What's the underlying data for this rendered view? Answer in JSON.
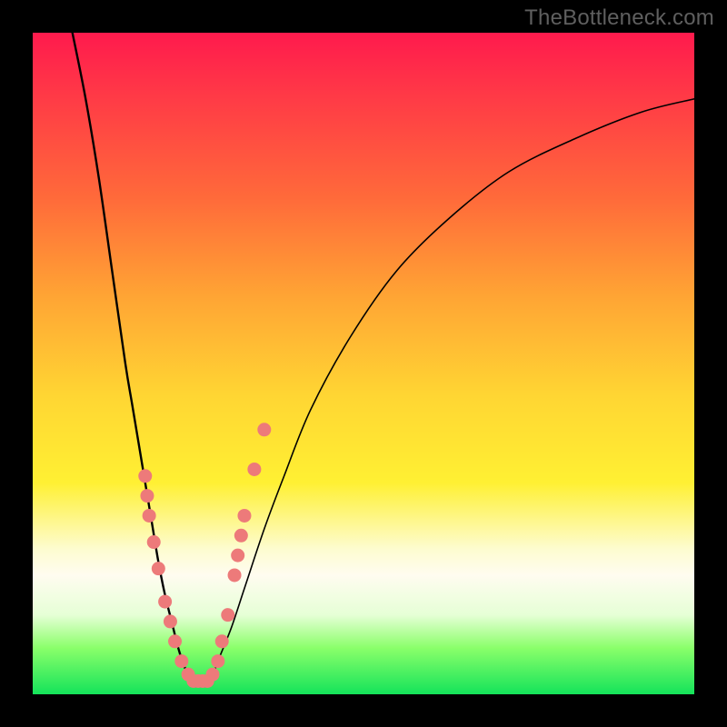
{
  "watermark": "TheBottleneck.com",
  "chart_data": {
    "type": "line",
    "title": "",
    "xlabel": "",
    "ylabel": "",
    "xlim": [
      0,
      100
    ],
    "ylim": [
      0,
      100
    ],
    "series": [
      {
        "name": "left-curve",
        "x": [
          6,
          8,
          10,
          12,
          14,
          15,
          16,
          17,
          18,
          19,
          20,
          21,
          22,
          23,
          24
        ],
        "y": [
          100,
          90,
          78,
          64,
          50,
          44,
          38,
          32,
          26,
          20,
          15,
          11,
          7,
          4,
          2
        ]
      },
      {
        "name": "right-curve",
        "x": [
          27,
          28,
          30,
          32,
          35,
          38,
          42,
          48,
          55,
          63,
          72,
          82,
          92,
          100
        ],
        "y": [
          2,
          5,
          10,
          16,
          25,
          33,
          43,
          54,
          64,
          72,
          79,
          84,
          88,
          90
        ]
      }
    ],
    "scatter_points": {
      "name": "highlight-dots",
      "color": "#ed7a7a",
      "points": [
        {
          "x": 17.0,
          "y": 33
        },
        {
          "x": 17.3,
          "y": 30
        },
        {
          "x": 17.6,
          "y": 27
        },
        {
          "x": 18.3,
          "y": 23
        },
        {
          "x": 19.0,
          "y": 19
        },
        {
          "x": 20.0,
          "y": 14
        },
        {
          "x": 20.8,
          "y": 11
        },
        {
          "x": 21.5,
          "y": 8
        },
        {
          "x": 22.5,
          "y": 5
        },
        {
          "x": 23.5,
          "y": 3
        },
        {
          "x": 24.3,
          "y": 2
        },
        {
          "x": 25.0,
          "y": 2
        },
        {
          "x": 25.7,
          "y": 2
        },
        {
          "x": 26.4,
          "y": 2
        },
        {
          "x": 27.2,
          "y": 3
        },
        {
          "x": 28.0,
          "y": 5
        },
        {
          "x": 28.6,
          "y": 8
        },
        {
          "x": 29.5,
          "y": 12
        },
        {
          "x": 30.5,
          "y": 18
        },
        {
          "x": 31.0,
          "y": 21
        },
        {
          "x": 31.5,
          "y": 24
        },
        {
          "x": 32.0,
          "y": 27
        },
        {
          "x": 33.5,
          "y": 34
        },
        {
          "x": 35.0,
          "y": 40
        }
      ]
    }
  }
}
